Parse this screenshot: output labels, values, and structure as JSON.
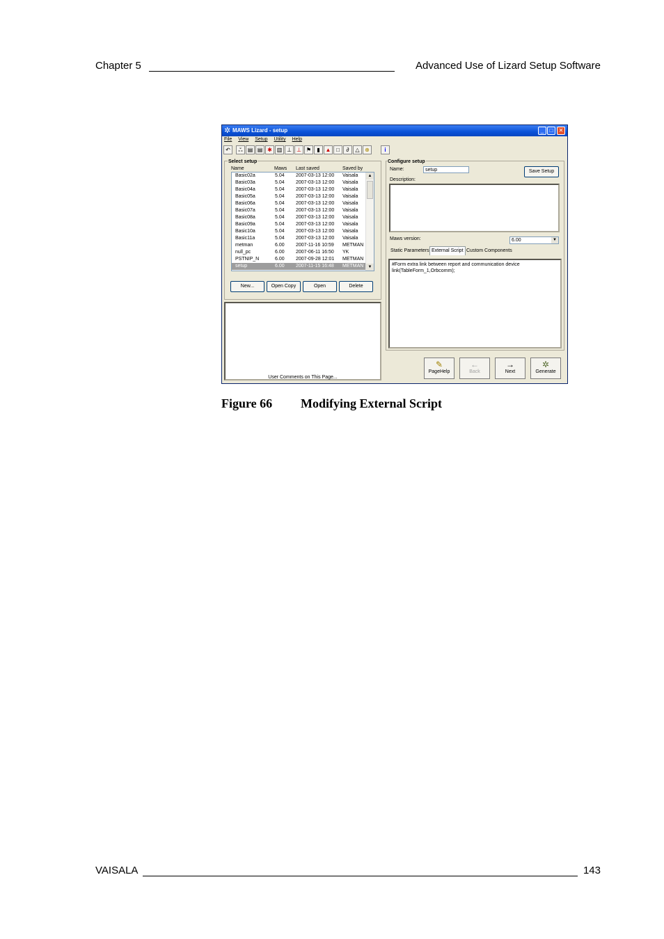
{
  "header": {
    "chapter": "Chapter 5",
    "title": "Advanced Use of Lizard Setup Software"
  },
  "figure": {
    "number": "Figure 66",
    "caption": "Modifying External Script"
  },
  "window": {
    "title": "MAWS Lizard - setup",
    "menu": [
      "File",
      "View",
      "Setup",
      "Utility",
      "Help"
    ],
    "toolbar_icons": [
      "back-icon",
      "network-icon",
      "dev-icon",
      "dev2-icon",
      "sensor-icon",
      "logger-icon",
      "tower-icon",
      "tower2-icon",
      "flag-icon",
      "gauge-icon",
      "chart-icon",
      "page-icon",
      "link-icon",
      "bell-icon",
      "globe-icon",
      "info-icon"
    ],
    "select_setup": {
      "label": "Select setup",
      "columns": [
        "Name",
        "Maws",
        "Last saved",
        "Saved by"
      ],
      "rows": [
        [
          "Basic02a",
          "5.04",
          "2007-03-13 12:00",
          "Vaisala"
        ],
        [
          "Basic03a",
          "5.04",
          "2007-03-13 12:00",
          "Vaisala"
        ],
        [
          "Basic04a",
          "5.04",
          "2007-03-13 12:00",
          "Vaisala"
        ],
        [
          "Basic05a",
          "5.04",
          "2007-03-13 12:00",
          "Vaisala"
        ],
        [
          "Basic06a",
          "5.04",
          "2007-03-13 12:00",
          "Vaisala"
        ],
        [
          "Basic07a",
          "5.04",
          "2007-03-13 12:00",
          "Vaisala"
        ],
        [
          "Basic08a",
          "5.04",
          "2007-03-13 12:00",
          "Vaisala"
        ],
        [
          "Basic09a",
          "5.04",
          "2007-03-13 12:00",
          "Vaisala"
        ],
        [
          "Basic10a",
          "5.04",
          "2007-03-13 12:00",
          "Vaisala"
        ],
        [
          "Basic11a",
          "5.04",
          "2007-03-13 12:00",
          "Vaisala"
        ],
        [
          "metman",
          "6.00",
          "2007-11-16 10:59",
          "METMAN"
        ],
        [
          "null_pc",
          "6.00",
          "2007-06-11 16:50",
          "YK"
        ],
        [
          "PSTNIP_N",
          "6.00",
          "2007-09-28 12:01",
          "METMAN"
        ],
        [
          "setup",
          "6.00",
          "2007-11-15 16:48",
          "METMAN"
        ]
      ],
      "selected_index": 13,
      "buttons": {
        "new": "New...",
        "open_copy": "Open Copy",
        "open": "Open",
        "delete": "Delete"
      }
    },
    "comments_label": "User Comments on This Page...",
    "configure": {
      "label": "Configure setup",
      "name_label": "Name:",
      "name_value": "setup",
      "save_button": "Save Setup",
      "description_label": "Description:",
      "maws_version_label": "Maws version:",
      "maws_version_value": "6.00",
      "tabs": [
        "Static Parameters",
        "External Script",
        "Custom Components"
      ],
      "active_tab": "External Script",
      "script_lines": [
        "#Form extra link between report and communication device",
        "link(TableForm_1,Orbcomm);"
      ]
    },
    "nav_buttons": {
      "pagehelp": "PageHelp",
      "back": "Back",
      "next": "Next",
      "generate": "Generate"
    }
  },
  "footer": {
    "company": "VAISALA",
    "page": "143"
  }
}
